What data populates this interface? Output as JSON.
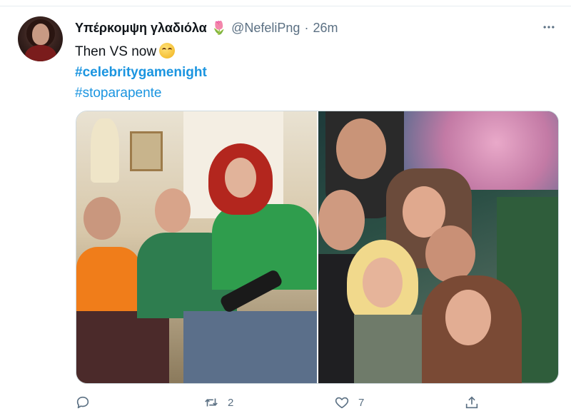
{
  "tweet": {
    "display_name": "Υπέρκομψη γλαδιόλα",
    "name_emoji": "🌷",
    "handle": "@NefeliPng",
    "separator": "·",
    "time": "26m",
    "text": "Then VS now",
    "emoji_icon": "face-with-rolling-eyes-emoji",
    "hashtags": [
      "#celebritygamenight",
      "#stoparapente"
    ],
    "more_icon": "more-horizontal-icon"
  },
  "media": {
    "images": [
      {
        "name": "then-photo"
      },
      {
        "name": "now-photo"
      }
    ]
  },
  "actions": {
    "reply": {
      "icon": "reply-icon",
      "count": ""
    },
    "retweet": {
      "icon": "retweet-icon",
      "count": "2"
    },
    "like": {
      "icon": "heart-icon",
      "count": "7"
    },
    "share": {
      "icon": "share-icon",
      "count": ""
    }
  },
  "colors": {
    "link": "#1b95e0",
    "secondary_text": "#5b7083",
    "primary_text": "#0f1419"
  }
}
